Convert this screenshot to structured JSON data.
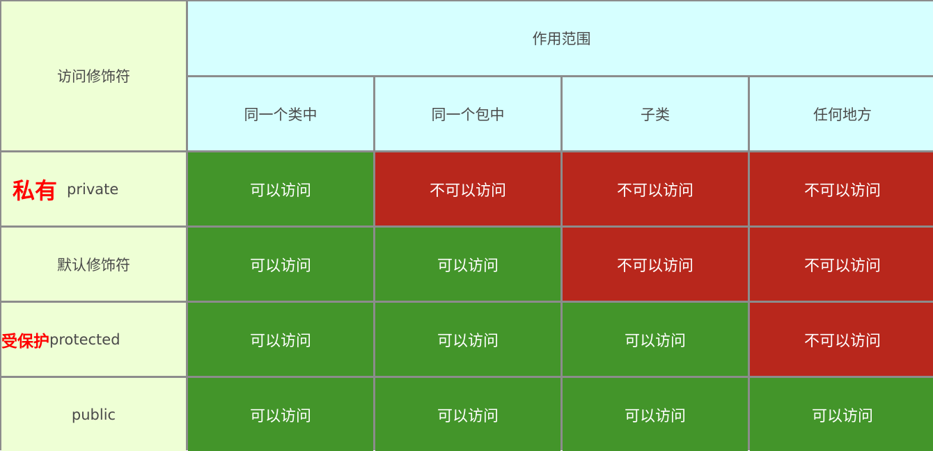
{
  "header": {
    "corner_label": "访问修饰符",
    "scope_title": "作用范围",
    "columns": [
      "同一个类中",
      "同一个包中",
      "子类",
      "任何地方"
    ]
  },
  "rows": [
    {
      "annotation": "私有",
      "modifier": "private",
      "cells": [
        "可以访问",
        "不可以访问",
        "不可以访问",
        "不可以访问"
      ],
      "allowed": [
        true,
        false,
        false,
        false
      ]
    },
    {
      "annotation": "",
      "modifier": "默认修饰符",
      "cells": [
        "可以访问",
        "可以访问",
        "不可以访问",
        "不可以访问"
      ],
      "allowed": [
        true,
        true,
        false,
        false
      ]
    },
    {
      "annotation": "受保护",
      "modifier": "protected",
      "cells": [
        "可以访问",
        "可以访问",
        "可以访问",
        "不可以访问"
      ],
      "allowed": [
        true,
        true,
        true,
        false
      ]
    },
    {
      "annotation": "",
      "modifier": "public",
      "cells": [
        "可以访问",
        "可以访问",
        "可以访问",
        "可以访问"
      ],
      "allowed": [
        true,
        true,
        true,
        true
      ]
    }
  ],
  "colors": {
    "allowed": "#43952a",
    "denied": "#b8271c",
    "header_bg": "#d6ffff",
    "modifier_bg": "#eeffd5",
    "annotation": "#ff0000",
    "grid_line": "#8c8c8c"
  }
}
